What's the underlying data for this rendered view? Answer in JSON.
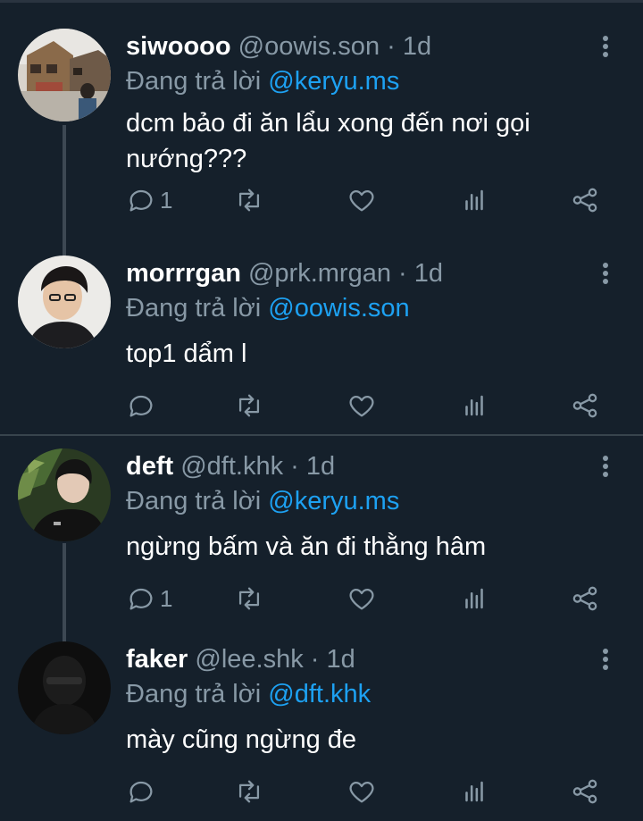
{
  "colors": {
    "background": "#15202b",
    "mention": "#1da1f2",
    "muted": "#8899a6",
    "divider": "#38444d"
  },
  "reply_prefix": "Đang trả lời",
  "separator": "·",
  "tweets": [
    {
      "name": "siwoooo",
      "handle": "@oowis.son",
      "time": "1d",
      "reply_to": "@keryu.ms",
      "text": "dcm bảo đi ăn lẩu xong đến nơi gọi nướng???",
      "reply_count": "1",
      "avatar_icon": "avatar-street-photo"
    },
    {
      "name": "morrrgan",
      "handle": "@prk.mrgan",
      "time": "1d",
      "reply_to": "@oowis.son",
      "text": "top1 dẩm l",
      "reply_count": "",
      "avatar_icon": "avatar-portrait"
    },
    {
      "name": "deft",
      "handle": "@dft.khk",
      "time": "1d",
      "reply_to": "@keryu.ms",
      "text": "ngừng bấm và ăn đi thằng hâm",
      "reply_count": "1",
      "avatar_icon": "avatar-portrait-plants"
    },
    {
      "name": "faker",
      "handle": "@lee.shk",
      "time": "1d",
      "reply_to": "@dft.khk",
      "text": "mày cũng ngừng đe",
      "reply_count": "",
      "avatar_icon": "avatar-dark-masked"
    }
  ]
}
